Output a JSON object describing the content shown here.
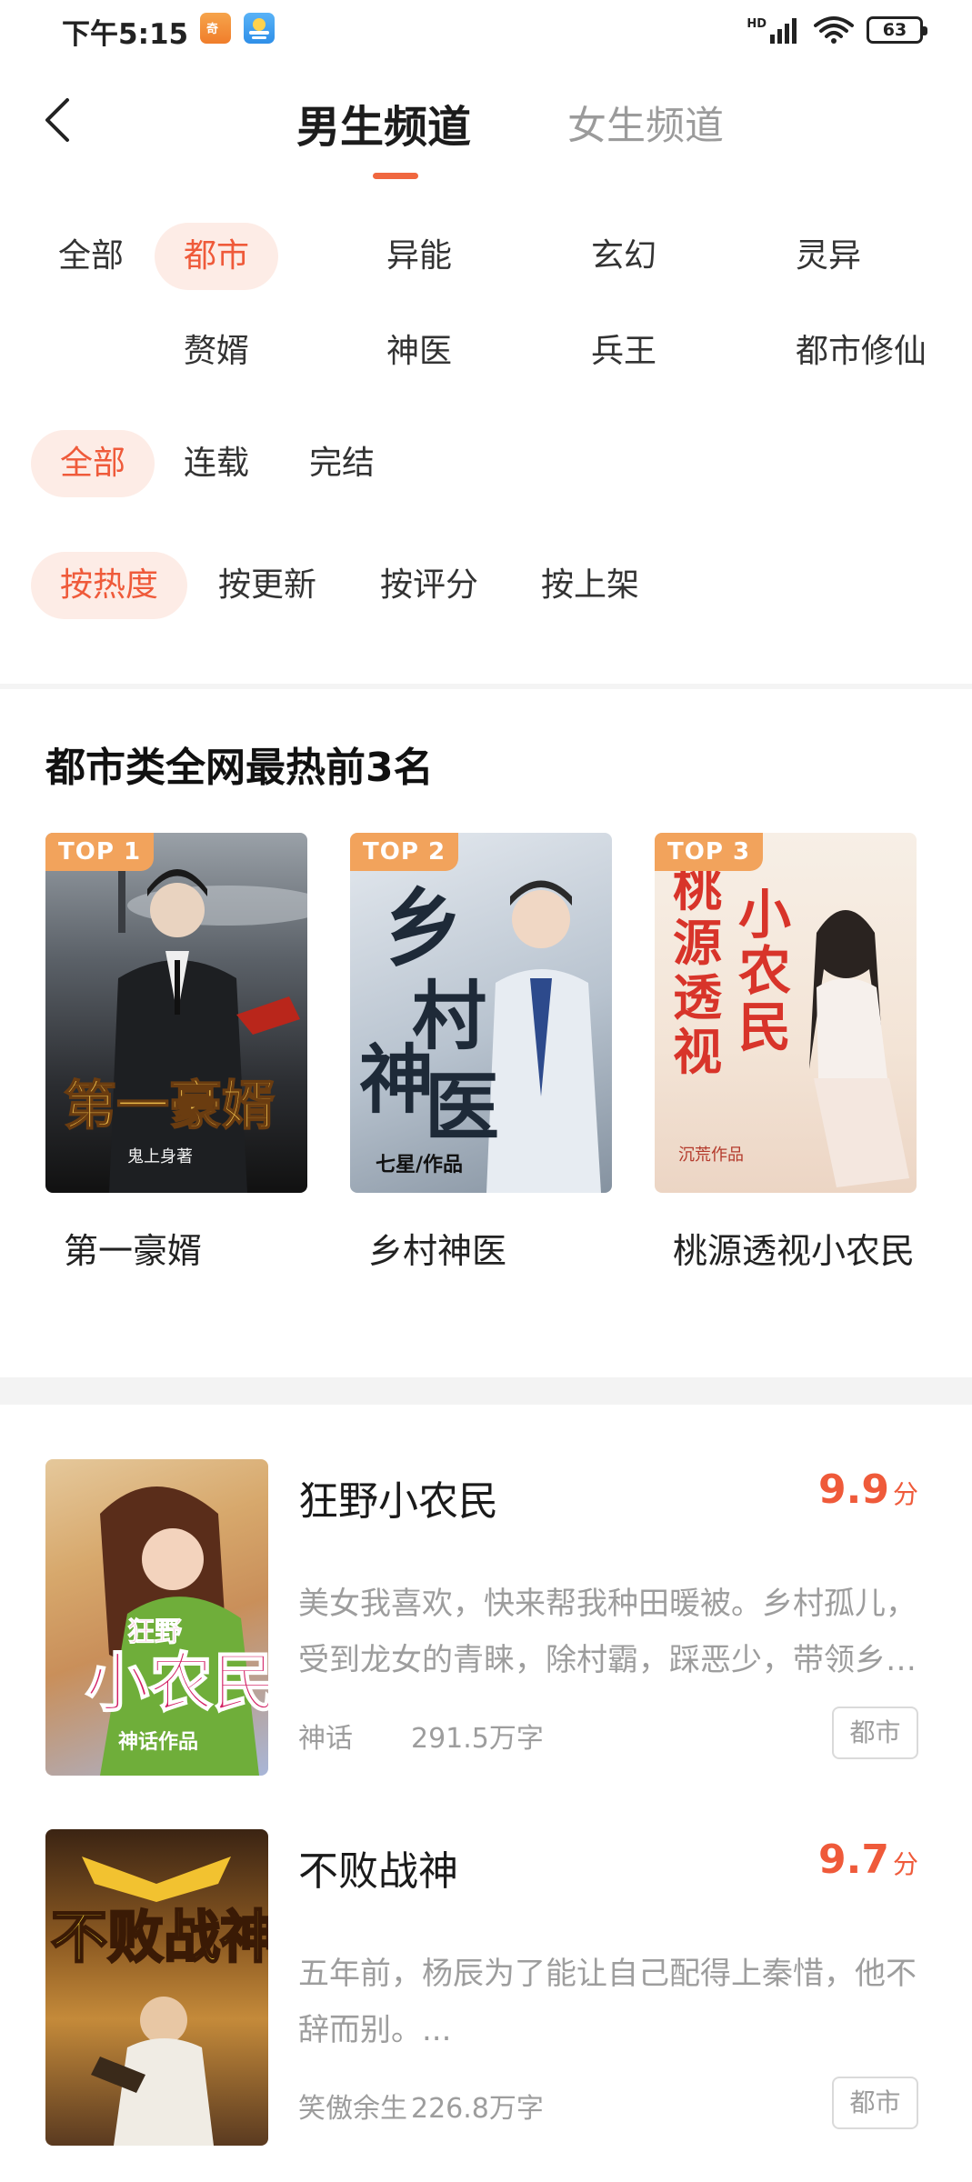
{
  "status_bar": {
    "time": "下午5:15",
    "network_label": "HD",
    "battery": "63"
  },
  "header": {
    "tabs": [
      {
        "label": "男生频道",
        "active": true
      },
      {
        "label": "女生频道",
        "active": false
      }
    ]
  },
  "filters": {
    "categories": [
      "全部",
      "都市",
      "异能",
      "玄幻",
      "灵异",
      "赘婿",
      "神医",
      "兵王",
      "都市修仙"
    ],
    "category_selected": "都市",
    "status": [
      "全部",
      "连载",
      "完结"
    ],
    "status_selected": "全部",
    "sort": [
      "按热度",
      "按更新",
      "按评分",
      "按上架"
    ],
    "sort_selected": "按热度"
  },
  "top_section": {
    "title": "都市类全网最热前3名",
    "books": [
      {
        "badge": "TOP 1",
        "name": "第一豪婿",
        "cover_text": "第一豪婿",
        "cover_author": "鬼上身著"
      },
      {
        "badge": "TOP 2",
        "name": "乡村神医",
        "cover_text": "乡村神医",
        "cover_author": "七星/作品"
      },
      {
        "badge": "TOP 3",
        "name": "桃源透视小农民",
        "cover_text": "桃源透视小农民",
        "cover_author": "沉荒作品"
      }
    ]
  },
  "book_list": [
    {
      "title": "狂野小农民",
      "score": "9.9",
      "score_unit": "分",
      "desc": "美女我喜欢，快来帮我种田暖被。乡村孤儿，受到龙女的青睐，除村霸，踩恶少，带领乡亲们走上致富之路……",
      "author": "神话",
      "words": "291.5万字",
      "tag": "都市",
      "cover_text": "狂野小农民",
      "cover_author": "神话作品"
    },
    {
      "title": "不败战神",
      "score": "9.7",
      "score_unit": "分",
      "desc": "五年前，杨辰为了能让自己配得上秦惜，他不辞而别。...",
      "author": "笑傲余生",
      "words": "226.8万字",
      "tag": "都市",
      "cover_text": "不败战神"
    }
  ],
  "colors": {
    "accent": "#ef5a3a",
    "accent_bg": "#fdece6",
    "badge": "#f2a35c"
  }
}
